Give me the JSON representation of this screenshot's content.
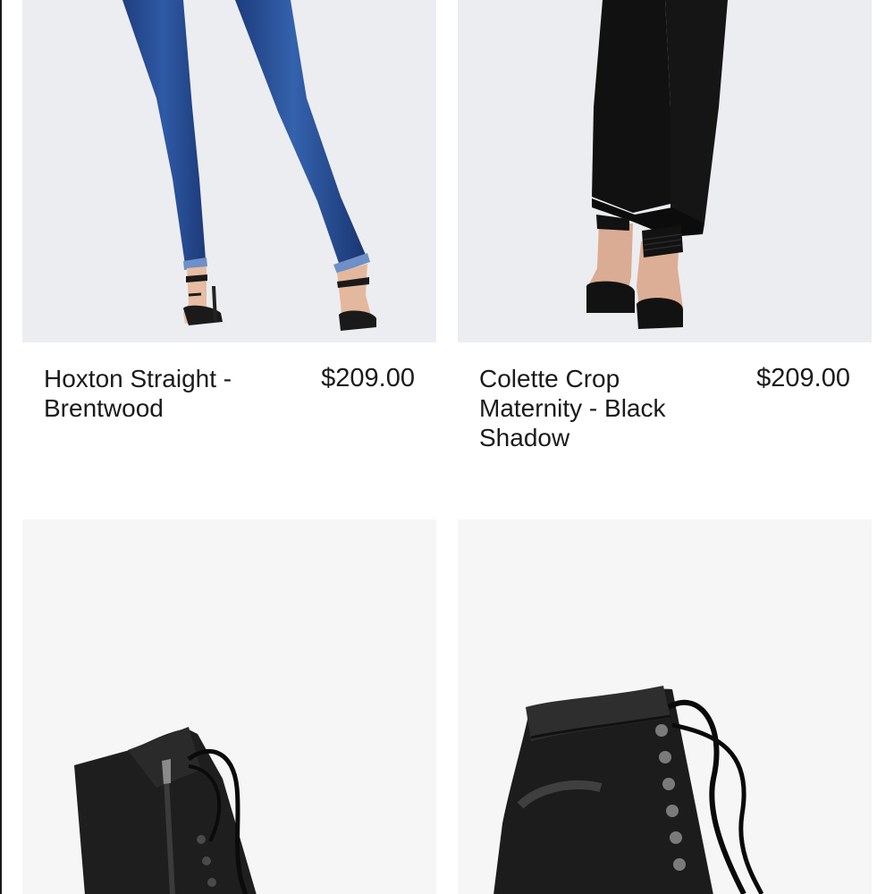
{
  "products": [
    {
      "name": "Hoxton Straight - Brentwood",
      "price": "$209.00",
      "image": "blue-straight-jeans-photo"
    },
    {
      "name": "Colette Crop Maternity - Black Shadow",
      "price": "$209.00",
      "image": "black-cropped-jeans-photo"
    },
    {
      "image": "black-suede-lace-up-boot-photo"
    },
    {
      "image": "black-leather-lace-up-boot-photo"
    }
  ]
}
